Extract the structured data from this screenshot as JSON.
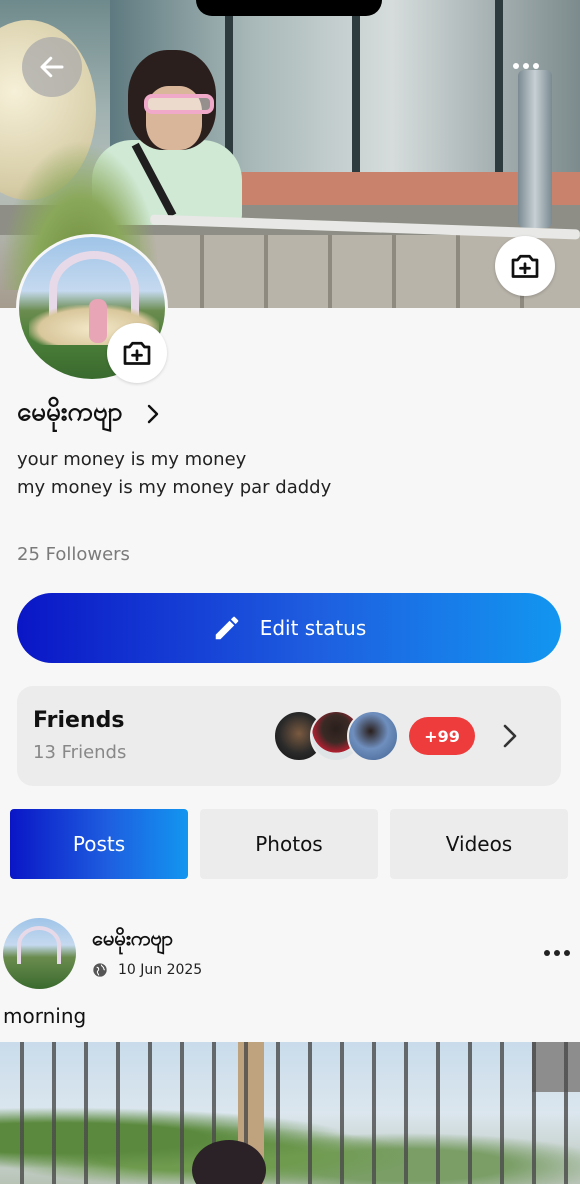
{
  "profile": {
    "name": "မေမိုးကဗျာ",
    "bio_lines": [
      "your money is my money",
      "my money is my money par daddy"
    ],
    "followers": "25 Followers"
  },
  "actions": {
    "edit_status_label": "Edit status"
  },
  "friends": {
    "title": "Friends",
    "count_label": "13  Friends",
    "more_badge": "+99"
  },
  "tabs": [
    {
      "label": "Posts",
      "active": true
    },
    {
      "label": "Photos",
      "active": false
    },
    {
      "label": "Videos",
      "active": false
    }
  ],
  "post": {
    "author": "မေမိုးကဗျာ",
    "date": "10 Jun 2025",
    "text": "morning",
    "privacy_icon": "globe-icon"
  },
  "colors": {
    "accent_gradient_start": "#0a16c6",
    "accent_gradient_end": "#1296f0",
    "badge_red": "#ee3b3b"
  }
}
